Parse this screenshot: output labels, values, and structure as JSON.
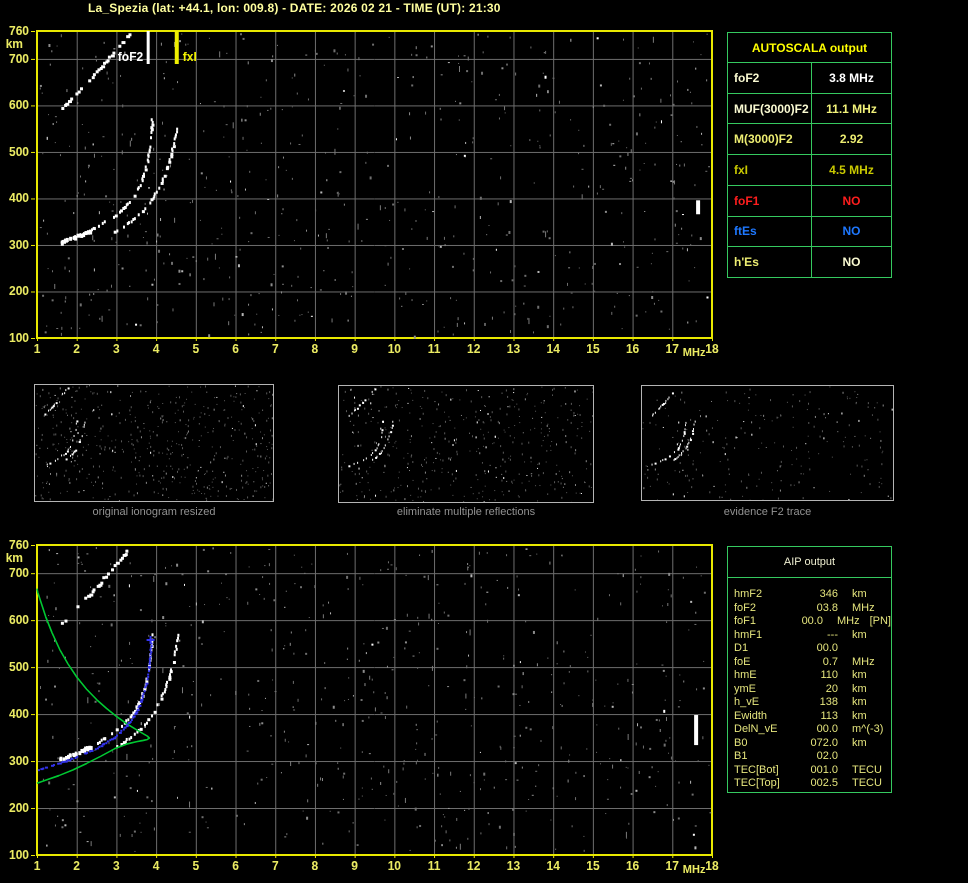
{
  "title": "La_Spezia (lat: +44.1, lon: 009.8) - DATE: 2026 02 21 - TIME (UT): 21:30",
  "autoscala": {
    "title": "AUTOSCALA output",
    "title_color": "#ffff00",
    "border_color": "#35c95f",
    "rows": [
      {
        "label": "foF2",
        "value": "3.8 MHz",
        "label_color": "#fafad2",
        "value_color": "#ffffff"
      },
      {
        "label": "MUF(3000)F2",
        "value": "11.1 MHz",
        "label_color": "#fafad2",
        "value_color": "#f2f27a"
      },
      {
        "label": "M(3000)F2",
        "value": "2.92",
        "label_color": "#eded72",
        "value_color": "#eded72"
      },
      {
        "label": "fxI",
        "value": "4.5 MHz",
        "label_color": "#c9c900",
        "value_color": "#c9c900"
      },
      {
        "label": "foF1",
        "value": "NO",
        "label_color": "#ff1e1e",
        "value_color": "#ff1e1e"
      },
      {
        "label": "ftEs",
        "value": "NO",
        "label_color": "#1e78ff",
        "value_color": "#1e78ff"
      },
      {
        "label": "h'Es",
        "value": "NO",
        "label_color": "#eded72",
        "value_color": "#fafad2"
      }
    ]
  },
  "aip": {
    "title": "AIP output",
    "rows": [
      {
        "label": "hmF2",
        "value": "346",
        "unit": "km"
      },
      {
        "label": "foF2",
        "value": "03.8",
        "unit": "MHz"
      },
      {
        "label": "foF1",
        "value": "00.0",
        "unit": "MHz",
        "note": "[PN]"
      },
      {
        "label": "hmF1",
        "value": "---",
        "unit": "km"
      },
      {
        "label": "D1",
        "value": "00.0",
        "unit": ""
      },
      {
        "label": "foE",
        "value": "0.7",
        "unit": "MHz"
      },
      {
        "label": "hmE",
        "value": "110",
        "unit": "km"
      },
      {
        "label": "ymE",
        "value": "20",
        "unit": "km"
      },
      {
        "label": "h_vE",
        "value": "138",
        "unit": "km"
      },
      {
        "label": "Ewidth",
        "value": "113",
        "unit": "km"
      },
      {
        "label": "DelN_vE",
        "value": "00.0",
        "unit": "m^(-3)"
      },
      {
        "label": "B0",
        "value": "072.0",
        "unit": "km"
      },
      {
        "label": "B1",
        "value": "02.0",
        "unit": ""
      },
      {
        "label": "TEC[Bot]",
        "value": "001.0",
        "unit": "TECU"
      },
      {
        "label": "TEC[Top]",
        "value": "002.5",
        "unit": "TECU"
      }
    ]
  },
  "panels": [
    {
      "caption": "original ionogram resized",
      "noise": 520,
      "seed": 7
    },
    {
      "caption": "eliminate multiple reflections",
      "noise": 430,
      "seed": 8
    },
    {
      "caption": "evidence F2 trace",
      "noise": 230,
      "seed": 9
    }
  ],
  "chart_data": [
    {
      "id": "top_ionogram",
      "type": "scatter",
      "xlabel": "MHz",
      "ylabel": "km",
      "xlim": [
        1,
        18
      ],
      "ylim": [
        100,
        760
      ],
      "xticks": [
        1,
        2,
        3,
        4,
        5,
        6,
        7,
        8,
        9,
        10,
        11,
        12,
        13,
        14,
        15,
        16,
        17,
        18
      ],
      "yticks": [
        760,
        700,
        600,
        500,
        400,
        300,
        200,
        100
      ],
      "grid": true,
      "frame_color": "#e8e800",
      "tick_color": "#ebeb63",
      "grid_color": "#6e6e6e",
      "seed": 12345,
      "noise": 560,
      "markers": [
        {
          "label": "foF2",
          "freq": 3.8,
          "color": "#ffffff"
        },
        {
          "label": "fxI",
          "freq": 4.52,
          "color": "#f0f000"
        }
      ],
      "series": [
        {
          "name": "oblique-spread-trace",
          "color": "#ffffff",
          "kind": "dots-thick",
          "points": [
            [
              1.62,
              598
            ],
            [
              1.78,
              612
            ],
            [
              1.95,
              628
            ],
            [
              2.12,
              643
            ],
            [
              2.3,
              658
            ],
            [
              2.48,
              674
            ],
            [
              2.66,
              692
            ],
            [
              2.84,
              710
            ],
            [
              3.0,
              726
            ],
            [
              3.15,
              740
            ],
            [
              3.3,
              754
            ],
            [
              3.38,
              760
            ]
          ]
        },
        {
          "name": "F2-o-mode-trace",
          "color": "#ffffff",
          "kind": "dots-omode",
          "points": [
            [
              1.58,
              308
            ],
            [
              1.75,
              314
            ],
            [
              1.95,
              320
            ],
            [
              2.15,
              327
            ],
            [
              2.35,
              335
            ],
            [
              2.55,
              344
            ],
            [
              2.75,
              355
            ],
            [
              2.95,
              367
            ],
            [
              3.15,
              381
            ],
            [
              3.32,
              396
            ],
            [
              3.47,
              414
            ],
            [
              3.6,
              436
            ],
            [
              3.7,
              460
            ],
            [
              3.78,
              487
            ],
            [
              3.82,
              514
            ],
            [
              3.85,
              540
            ],
            [
              3.87,
              562
            ],
            [
              3.88,
              578
            ]
          ]
        },
        {
          "name": "F2-x-mode-trace",
          "color": "#ffffff",
          "kind": "dots",
          "points": [
            [
              2.95,
              332
            ],
            [
              3.15,
              342
            ],
            [
              3.35,
              354
            ],
            [
              3.55,
              368
            ],
            [
              3.73,
              385
            ],
            [
              3.9,
              404
            ],
            [
              4.05,
              426
            ],
            [
              4.18,
              451
            ],
            [
              4.29,
              477
            ],
            [
              4.38,
              504
            ],
            [
              4.45,
              530
            ],
            [
              4.5,
              553
            ],
            [
              4.53,
              576
            ]
          ]
        },
        {
          "name": "interference-blob",
          "color": "#ffffff",
          "kind": "blob",
          "points": [
            [
              17.65,
              366
            ],
            [
              17.65,
              396
            ]
          ]
        }
      ]
    },
    {
      "id": "bottom_ionogram_with_profile",
      "type": "scatter",
      "xlabel": "MHz",
      "ylabel": "km",
      "xlim": [
        1,
        18
      ],
      "ylim": [
        100,
        760
      ],
      "xticks": [
        1,
        2,
        3,
        4,
        5,
        6,
        7,
        8,
        9,
        10,
        11,
        12,
        13,
        14,
        15,
        16,
        17,
        18
      ],
      "yticks": [
        760,
        700,
        600,
        500,
        400,
        300,
        200,
        100
      ],
      "grid": true,
      "frame_color": "#e8e800",
      "tick_color": "#ebeb63",
      "grid_color": "#6e6e6e",
      "seed": 54321,
      "noise": 560,
      "markers": [],
      "series": [
        {
          "name": "oblique-spread-trace",
          "color": "#ffffff",
          "kind": "dots-thick",
          "points": [
            [
              1.62,
              598
            ],
            [
              1.78,
              612
            ],
            [
              1.95,
              628
            ],
            [
              2.12,
              643
            ],
            [
              2.3,
              658
            ],
            [
              2.48,
              674
            ],
            [
              2.66,
              692
            ],
            [
              2.84,
              710
            ],
            [
              3.0,
              726
            ],
            [
              3.15,
              740
            ],
            [
              3.3,
              754
            ],
            [
              3.38,
              760
            ]
          ]
        },
        {
          "name": "F2-o-mode-trace",
          "color": "#ffffff",
          "kind": "dots-omode",
          "points": [
            [
              1.58,
              308
            ],
            [
              1.75,
              314
            ],
            [
              1.95,
              320
            ],
            [
              2.15,
              327
            ],
            [
              2.35,
              335
            ],
            [
              2.55,
              344
            ],
            [
              2.75,
              355
            ],
            [
              2.95,
              367
            ],
            [
              3.15,
              381
            ],
            [
              3.32,
              396
            ],
            [
              3.47,
              414
            ],
            [
              3.6,
              436
            ],
            [
              3.7,
              460
            ],
            [
              3.78,
              487
            ],
            [
              3.82,
              514
            ],
            [
              3.85,
              540
            ],
            [
              3.87,
              562
            ],
            [
              3.88,
              578
            ]
          ]
        },
        {
          "name": "F2-x-mode-trace",
          "color": "#ffffff",
          "kind": "dots",
          "points": [
            [
              2.95,
              332
            ],
            [
              3.15,
              342
            ],
            [
              3.35,
              354
            ],
            [
              3.55,
              368
            ],
            [
              3.73,
              385
            ],
            [
              3.9,
              404
            ],
            [
              4.05,
              426
            ],
            [
              4.18,
              451
            ],
            [
              4.29,
              477
            ],
            [
              4.38,
              504
            ],
            [
              4.45,
              530
            ],
            [
              4.5,
              553
            ],
            [
              4.53,
              576
            ]
          ]
        },
        {
          "name": "interference-blob",
          "color": "#ffffff",
          "kind": "blob",
          "points": [
            [
              17.6,
              334
            ],
            [
              17.6,
              398
            ]
          ]
        },
        {
          "name": "electron-density-profile",
          "color": "#00c832",
          "kind": "line",
          "points": [
            [
              1.0,
              253
            ],
            [
              1.25,
              260
            ],
            [
              1.55,
              269
            ],
            [
              1.9,
              281
            ],
            [
              2.25,
              295
            ],
            [
              2.6,
              310
            ],
            [
              2.95,
              326
            ],
            [
              3.25,
              336
            ],
            [
              3.5,
              341
            ],
            [
              3.68,
              344
            ],
            [
              3.78,
              346
            ],
            [
              3.83,
              349
            ],
            [
              3.78,
              353
            ],
            [
              3.66,
              359
            ],
            [
              3.48,
              368
            ],
            [
              3.25,
              380
            ],
            [
              3.0,
              395
            ],
            [
              2.75,
              412
            ],
            [
              2.5,
              431
            ],
            [
              2.25,
              453
            ],
            [
              2.0,
              479
            ],
            [
              1.78,
              507
            ],
            [
              1.57,
              538
            ],
            [
              1.38,
              573
            ],
            [
              1.22,
              607
            ],
            [
              1.1,
              638
            ],
            [
              1.02,
              659
            ],
            [
              1.0,
              667
            ]
          ]
        },
        {
          "name": "fitted-o-trace",
          "color": "#3333ee",
          "kind": "dots-blue",
          "points": [
            [
              1.02,
              283
            ],
            [
              1.25,
              289
            ],
            [
              1.5,
              296
            ],
            [
              1.75,
              303
            ],
            [
              2.0,
              311
            ],
            [
              2.25,
              320
            ],
            [
              2.5,
              330
            ],
            [
              2.72,
              341
            ],
            [
              2.95,
              354
            ],
            [
              3.15,
              369
            ],
            [
              3.33,
              386
            ],
            [
              3.48,
              406
            ],
            [
              3.6,
              429
            ],
            [
              3.7,
              454
            ],
            [
              3.77,
              481
            ],
            [
              3.81,
              508
            ],
            [
              3.84,
              534
            ],
            [
              3.86,
              556
            ]
          ]
        },
        {
          "name": "hmF2-plus-marker",
          "color": "#3333ee",
          "kind": "plus",
          "points": [
            [
              3.86,
              558
            ]
          ]
        }
      ]
    }
  ]
}
